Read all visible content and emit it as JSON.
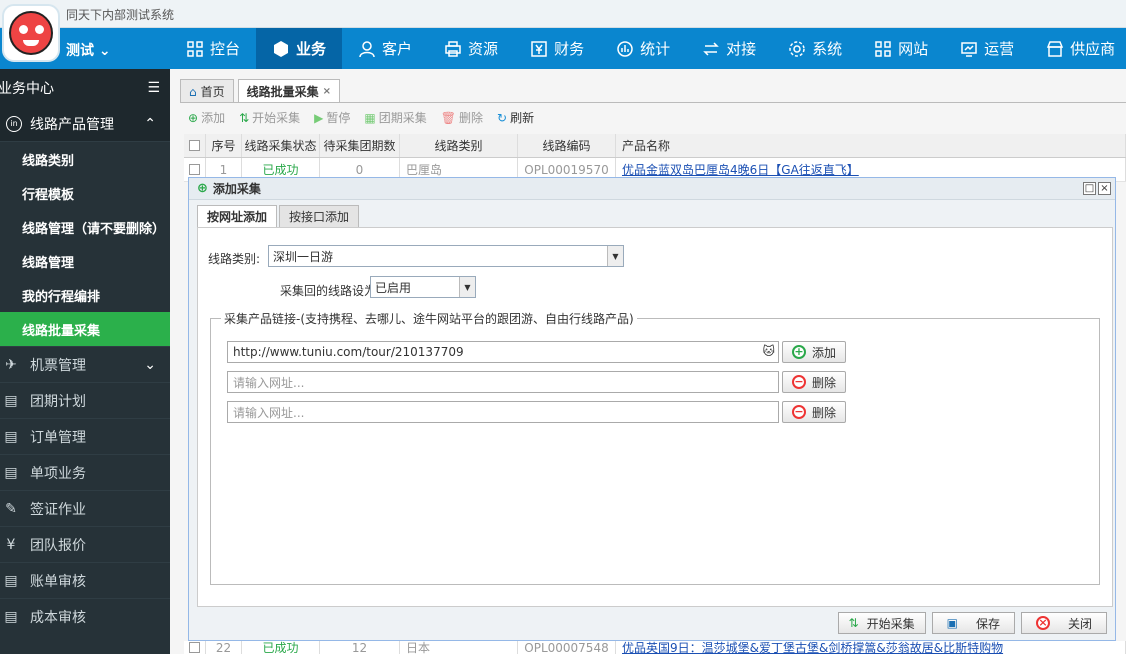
{
  "app": {
    "title": "同天下内部测试系统",
    "user": "测试",
    "user_arrow": "⌄"
  },
  "nav": [
    {
      "label": "控台",
      "icon": "grid-icon"
    },
    {
      "label": "业务",
      "icon": "cube-icon",
      "active": true
    },
    {
      "label": "客户",
      "icon": "user-icon"
    },
    {
      "label": "资源",
      "icon": "printer-icon"
    },
    {
      "label": "财务",
      "icon": "yen-icon"
    },
    {
      "label": "统计",
      "icon": "chart-icon"
    },
    {
      "label": "对接",
      "icon": "exchange-icon"
    },
    {
      "label": "系统",
      "icon": "gear-icon"
    },
    {
      "label": "网站",
      "icon": "grid-icon"
    },
    {
      "label": "运营",
      "icon": "monitor-icon"
    },
    {
      "label": "供应商",
      "icon": "store-icon"
    }
  ],
  "sidebar": {
    "title": "业务中心",
    "group": "线路产品管理",
    "sub_items": [
      "线路类别",
      "行程模板",
      "线路管理（请不要删除）",
      "线路管理",
      "我的行程编排",
      "线路批量采集"
    ],
    "menus": [
      "机票管理",
      "团期计划",
      "订单管理",
      "单项业务",
      "签证作业",
      "团队报价",
      "账单审核",
      "成本审核"
    ]
  },
  "tabs": {
    "home": "首页",
    "current": "线路批量采集",
    "close": "×"
  },
  "toolbar": {
    "add": "添加",
    "start": "开始采集",
    "pause": "暂停",
    "group": "团期采集",
    "delete": "删除",
    "refresh": "刷新"
  },
  "grid": {
    "headers": [
      "序号",
      "线路采集状态",
      "待采集团期数",
      "线路类别",
      "线路编码",
      "产品名称"
    ],
    "row1": {
      "no": "1",
      "status": "已成功",
      "pending": "0",
      "category": "巴厘岛",
      "code": "OPL00019570",
      "name": "优品金蓝双岛巴厘岛4晚6日【GA往返直飞】"
    },
    "row2": {
      "no": "22",
      "status": "已成功",
      "pending": "12",
      "category": "日本",
      "code": "OPL00007548",
      "name": "优品英国9日：温莎城堡&爱丁堡古堡&剑桥撑篙&莎翁故居&比斯特购物"
    }
  },
  "dialog": {
    "title": "添加采集",
    "tab_url": "按网址添加",
    "tab_api": "按接口添加",
    "category_label": "线路类别:",
    "category_value": "深圳一日游",
    "status_label": "采集回的线路设为:",
    "status_value": "已启用",
    "legend": "采集产品链接-(支持携程、去哪儿、途牛网站平台的跟团游、自由行线路产品)",
    "url1": "http://www.tuniu.com/tour/210137709",
    "placeholder": "请输入网址...",
    "add": "添加",
    "delete": "删除",
    "start": "开始采集",
    "save": "保存",
    "close": "关闭"
  }
}
